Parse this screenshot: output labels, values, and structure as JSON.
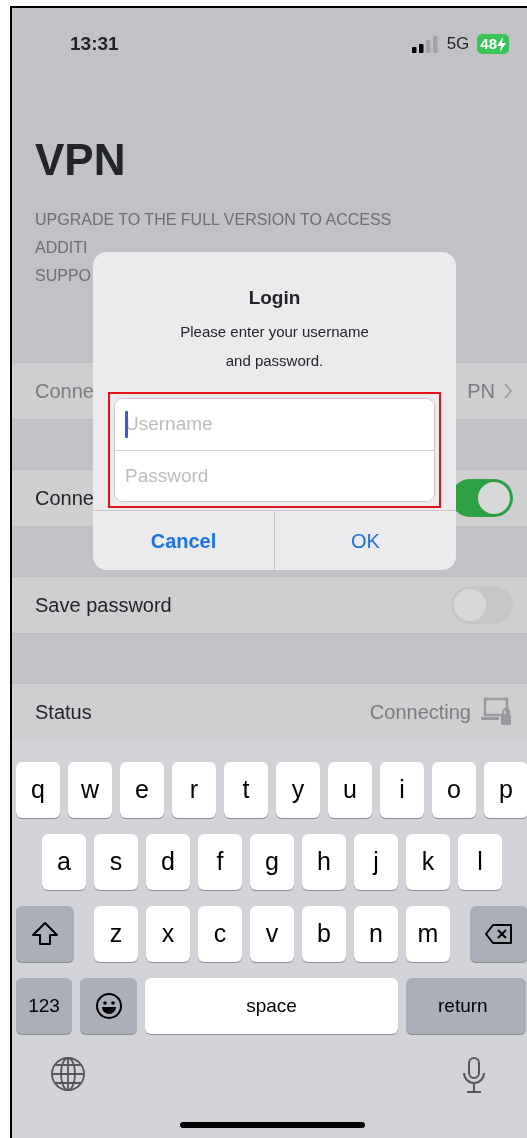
{
  "status_bar": {
    "time": "13:31",
    "network": "5G",
    "battery": "48"
  },
  "title": "VPN",
  "note_lines": [
    "UPGRADE TO THE FULL VERSION TO ACCESS",
    "ADDITI",
    "SUPPO"
  ],
  "sections": [
    {
      "rows": [
        {
          "kind": "link",
          "label": "Conne",
          "value": "PN"
        }
      ]
    },
    {
      "rows": [
        {
          "kind": "toggle",
          "label": "Conne",
          "on": true
        }
      ]
    },
    {
      "rows": [
        {
          "kind": "toggle",
          "label": "Save password",
          "on": false
        }
      ]
    },
    {
      "rows": [
        {
          "kind": "status",
          "label": "Status",
          "value": "Connecting"
        }
      ]
    }
  ],
  "dialog": {
    "title": "Login",
    "message": "Please enter your username and password.",
    "highlighted": true,
    "fields": [
      {
        "placeholder": "Username",
        "focused": true
      },
      {
        "placeholder": "Password",
        "focused": false
      }
    ],
    "buttons": [
      {
        "label": "Cancel",
        "kind": "cancel"
      },
      {
        "label": "OK",
        "kind": "default"
      }
    ]
  },
  "keyboard": {
    "rows": [
      {
        "keys": [
          {
            "kind": "letter",
            "label": "q"
          },
          {
            "kind": "letter",
            "label": "w"
          },
          {
            "kind": "letter",
            "label": "e"
          },
          {
            "kind": "letter",
            "label": "r"
          },
          {
            "kind": "letter",
            "label": "t"
          },
          {
            "kind": "letter",
            "label": "y"
          },
          {
            "kind": "letter",
            "label": "u"
          },
          {
            "kind": "letter",
            "label": "i"
          },
          {
            "kind": "letter",
            "label": "o"
          },
          {
            "kind": "letter",
            "label": "p"
          }
        ]
      },
      {
        "keys": [
          {
            "kind": "letter",
            "label": "a"
          },
          {
            "kind": "letter",
            "label": "s"
          },
          {
            "kind": "letter",
            "label": "d"
          },
          {
            "kind": "letter",
            "label": "f"
          },
          {
            "kind": "letter",
            "label": "g"
          },
          {
            "kind": "letter",
            "label": "h"
          },
          {
            "kind": "letter",
            "label": "j"
          },
          {
            "kind": "letter",
            "label": "k"
          },
          {
            "kind": "letter",
            "label": "l"
          }
        ]
      },
      {
        "keys": [
          {
            "kind": "shift"
          },
          {
            "kind": "letter",
            "label": "z"
          },
          {
            "kind": "letter",
            "label": "x"
          },
          {
            "kind": "letter",
            "label": "c"
          },
          {
            "kind": "letter",
            "label": "v"
          },
          {
            "kind": "letter",
            "label": "b"
          },
          {
            "kind": "letter",
            "label": "n"
          },
          {
            "kind": "letter",
            "label": "m"
          },
          {
            "kind": "delete"
          }
        ]
      },
      {
        "keys": [
          {
            "kind": "numbers",
            "label": "123"
          },
          {
            "kind": "emoji"
          },
          {
            "kind": "space",
            "label": "space"
          },
          {
            "kind": "return",
            "label": "return"
          }
        ]
      }
    ]
  }
}
